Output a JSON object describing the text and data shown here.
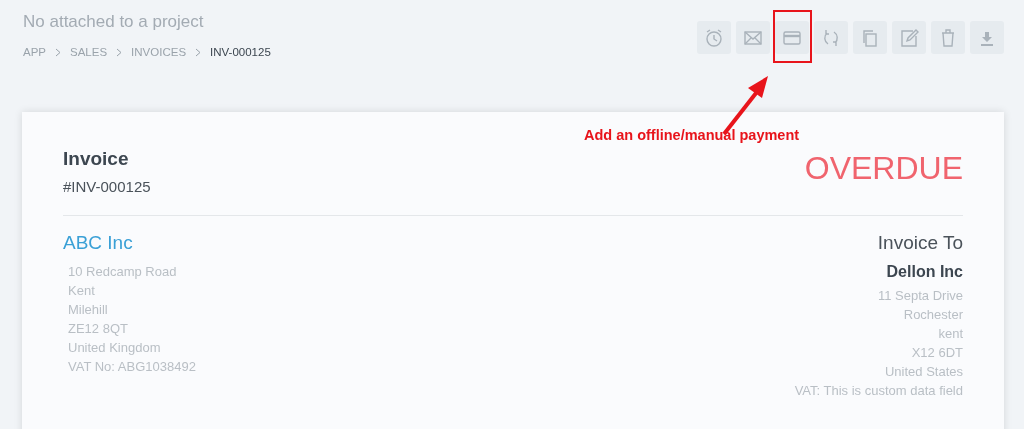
{
  "header": {
    "project": "No attached to a project",
    "breadcrumbs": [
      {
        "label": "APP",
        "current": false
      },
      {
        "label": "SALES",
        "current": false
      },
      {
        "label": "INVOICES",
        "current": false
      },
      {
        "label": "INV-000125",
        "current": true
      }
    ]
  },
  "actions": [
    {
      "kind": "reminder",
      "highlighted": false
    },
    {
      "kind": "email",
      "highlighted": false
    },
    {
      "kind": "payment",
      "highlighted": true
    },
    {
      "kind": "recurring",
      "highlighted": false
    },
    {
      "kind": "clone",
      "highlighted": false
    },
    {
      "kind": "edit",
      "highlighted": false
    },
    {
      "kind": "delete",
      "highlighted": false
    },
    {
      "kind": "download",
      "highlighted": false
    }
  ],
  "annotation": {
    "text": "Add an offline/manual payment"
  },
  "invoice": {
    "title": "Invoice",
    "number": "#INV-000125",
    "status": "OVERDUE",
    "from": {
      "name": "ABC Inc",
      "lines": [
        "10 Redcamp Road",
        "Kent",
        "Milehill",
        "ZE12 8QT",
        "United Kingdom",
        "VAT No: ABG1038492"
      ]
    },
    "to": {
      "heading": "Invoice To",
      "name": "Dellon Inc",
      "lines": [
        "11 Septa Drive",
        "Rochester",
        "kent",
        "X12 6DT",
        "United States",
        "VAT: This is custom data field"
      ]
    }
  }
}
